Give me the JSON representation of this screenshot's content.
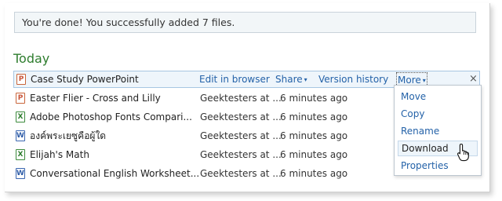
{
  "notification": {
    "message": "You're done! You successfully added 7 files."
  },
  "section": {
    "heading": "Today"
  },
  "rows": [
    {
      "icon": "powerpoint-file-icon",
      "icon_glyph": "P",
      "name": "Case Study PowerPoint",
      "owner": "",
      "modified": ""
    },
    {
      "icon": "powerpoint-file-icon",
      "icon_glyph": "P",
      "name": "Easter Flier - Cross and Lilly",
      "owner": "Geektesters at ...",
      "modified": "6 minutes ago"
    },
    {
      "icon": "excel-file-icon",
      "icon_glyph": "X",
      "name": "Adobe Photoshop Fonts Compari...",
      "owner": "Geektesters at ...",
      "modified": "6 minutes ago"
    },
    {
      "icon": "word-file-icon",
      "icon_glyph": "W",
      "name": "องค์พระเยซูคือผู้ใด",
      "owner": "Geektesters at ...",
      "modified": "6 minutes ago"
    },
    {
      "icon": "excel-file-icon",
      "icon_glyph": "X",
      "name": "Elijah's Math",
      "owner": "Geektesters at ...",
      "modified": "6 minutes ago"
    },
    {
      "icon": "word-file-icon",
      "icon_glyph": "W",
      "name": "Conversational English Worksheet...",
      "owner": "Geektesters at ...",
      "modified": "6 minutes ago"
    }
  ],
  "row_actions": {
    "edit_in_browser": "Edit in browser",
    "share": "Share",
    "version_history": "Version history",
    "more": "More",
    "close": "×",
    "caret": "▾"
  },
  "more_menu": {
    "items": [
      "Move",
      "Copy",
      "Rename",
      "Download",
      "Properties"
    ],
    "hovered": "Download"
  },
  "colors": {
    "link": "#2462a8",
    "heading": "#2e7d2e",
    "selected_row_bg": "#eef5fb"
  }
}
